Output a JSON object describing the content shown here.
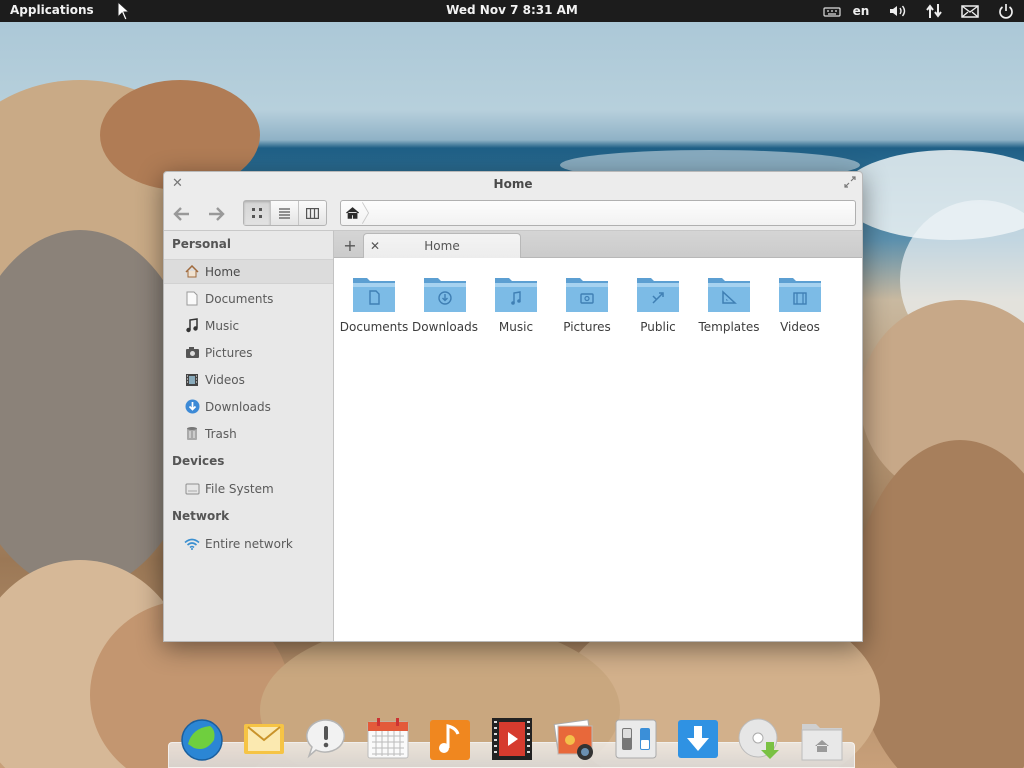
{
  "panel": {
    "applications_label": "Applications",
    "clock": "Wed Nov  7  8:31 AM",
    "language": "en",
    "indicators": [
      "keyboard-icon",
      "volume-icon",
      "network-icon",
      "mail-icon",
      "power-icon"
    ]
  },
  "window": {
    "title": "Home",
    "tab_label": "Home",
    "view_modes": [
      "icon-view",
      "list-view",
      "column-view"
    ],
    "active_view": "icon-view"
  },
  "sidebar": {
    "personal_title": "Personal",
    "devices_title": "Devices",
    "network_title": "Network",
    "personal": [
      {
        "label": "Home",
        "icon": "home-icon",
        "selected": true
      },
      {
        "label": "Documents",
        "icon": "document-icon"
      },
      {
        "label": "Music",
        "icon": "music-icon"
      },
      {
        "label": "Pictures",
        "icon": "pictures-icon"
      },
      {
        "label": "Videos",
        "icon": "videos-icon"
      },
      {
        "label": "Downloads",
        "icon": "downloads-icon"
      },
      {
        "label": "Trash",
        "icon": "trash-icon"
      }
    ],
    "devices": [
      {
        "label": "File System",
        "icon": "drive-icon"
      }
    ],
    "network": [
      {
        "label": "Entire network",
        "icon": "wifi-icon"
      }
    ]
  },
  "folders": [
    {
      "label": "Documents",
      "icon": "document"
    },
    {
      "label": "Downloads",
      "icon": "download"
    },
    {
      "label": "Music",
      "icon": "music"
    },
    {
      "label": "Pictures",
      "icon": "pictures"
    },
    {
      "label": "Public",
      "icon": "public"
    },
    {
      "label": "Templates",
      "icon": "templates"
    },
    {
      "label": "Videos",
      "icon": "video"
    }
  ],
  "dock": [
    "web-browser-icon",
    "mail-app-icon",
    "notes-icon",
    "calendar-icon",
    "music-player-icon",
    "video-player-icon",
    "photos-icon",
    "settings-icon",
    "software-center-icon",
    "disc-installer-icon",
    "files-icon"
  ],
  "colors": {
    "panel_bg": "#1c1c1c",
    "folder_blue": "#6aaedc",
    "selected_row": "#dcdcdc"
  }
}
